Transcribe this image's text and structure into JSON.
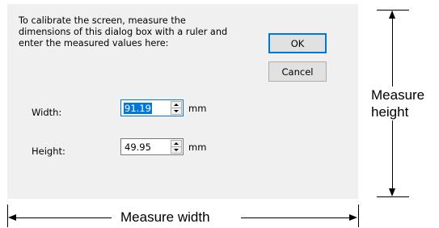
{
  "dialog": {
    "instructions": [
      "To calibrate the screen, measure the",
      "dimensions of this dialog box with a ruler and",
      "enter the measured values here:"
    ],
    "ok_label": "OK",
    "cancel_label": "Cancel",
    "width_field": {
      "label": "Width:",
      "value": "91.19",
      "unit": "mm"
    },
    "height_field": {
      "label": "Height:",
      "value": "49.95",
      "unit": "mm"
    },
    "accent_color": "#0078d7"
  },
  "annotations": {
    "measure_height": [
      "Measure",
      "height"
    ],
    "measure_width": "Measure width"
  }
}
